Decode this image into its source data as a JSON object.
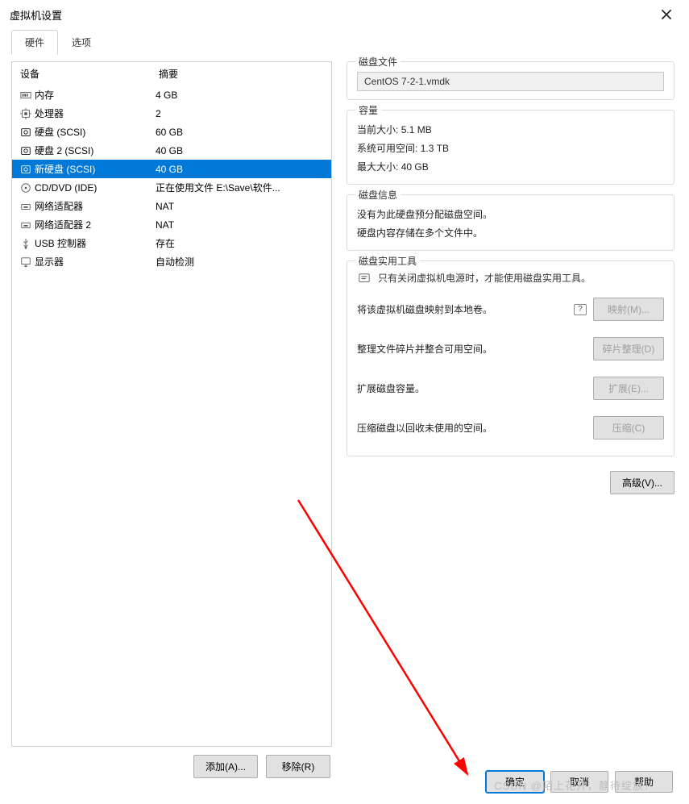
{
  "window": {
    "title": "虚拟机设置"
  },
  "tabs": {
    "hardware": "硬件",
    "options": "选项"
  },
  "headers": {
    "device": "设备",
    "summary": "摘要"
  },
  "hardware": [
    {
      "icon": "memory",
      "name": "内存",
      "summary": "4 GB",
      "selected": false
    },
    {
      "icon": "cpu",
      "name": "处理器",
      "summary": "2",
      "selected": false
    },
    {
      "icon": "disk",
      "name": "硬盘 (SCSI)",
      "summary": "60 GB",
      "selected": false
    },
    {
      "icon": "disk",
      "name": "硬盘 2 (SCSI)",
      "summary": "40 GB",
      "selected": false
    },
    {
      "icon": "disk",
      "name": "新硬盘 (SCSI)",
      "summary": "40 GB",
      "selected": true
    },
    {
      "icon": "cd",
      "name": "CD/DVD (IDE)",
      "summary": "正在使用文件 E:\\Save\\软件...",
      "selected": false
    },
    {
      "icon": "net",
      "name": "网络适配器",
      "summary": "NAT",
      "selected": false
    },
    {
      "icon": "net",
      "name": "网络适配器 2",
      "summary": "NAT",
      "selected": false
    },
    {
      "icon": "usb",
      "name": "USB 控制器",
      "summary": "存在",
      "selected": false
    },
    {
      "icon": "display",
      "name": "显示器",
      "summary": "自动检测",
      "selected": false
    }
  ],
  "leftButtons": {
    "add": "添加(A)...",
    "remove": "移除(R)"
  },
  "diskFile": {
    "title": "磁盘文件",
    "value": "CentOS 7-2-1.vmdk"
  },
  "capacity": {
    "title": "容量",
    "currentLabel": "当前大小:",
    "currentValue": "5.1 MB",
    "freeLabel": "系统可用空间:",
    "freeValue": "1.3 TB",
    "maxLabel": "最大大小:",
    "maxValue": "40 GB"
  },
  "diskInfo": {
    "title": "磁盘信息",
    "line1": "没有为此硬盘预分配磁盘空间。",
    "line2": "硬盘内容存储在多个文件中。"
  },
  "tools": {
    "title": "磁盘实用工具",
    "tip": "只有关闭虚拟机电源时，才能使用磁盘实用工具。",
    "mapText": "将该虚拟机磁盘映射到本地卷。",
    "mapBtn": "映射(M)...",
    "defragText": "整理文件碎片并整合可用空间。",
    "defragBtn": "碎片整理(D)",
    "expandText": "扩展磁盘容量。",
    "expandBtn": "扩展(E)...",
    "compactText": "压缩磁盘以回收未使用的空间。",
    "compactBtn": "压缩(C)"
  },
  "advanced": "高级(V)...",
  "bottom": {
    "ok": "确定",
    "cancel": "取消",
    "help": "帮助"
  },
  "watermark": "CSDN @陌上花开，静待绽放！"
}
